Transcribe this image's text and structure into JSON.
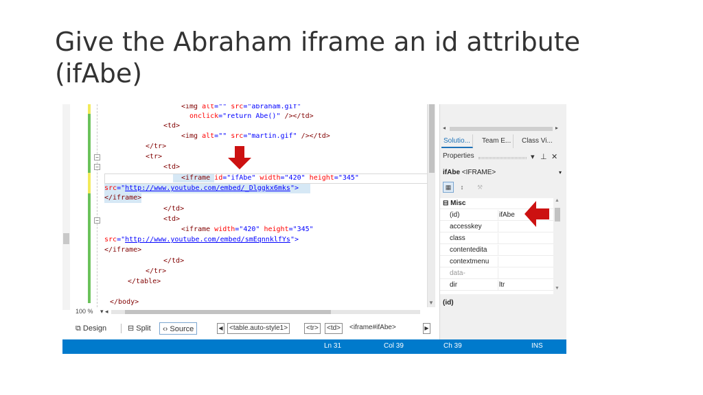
{
  "slide": {
    "title": "Give the Abraham iframe an id attribute (ifAbe)"
  },
  "code": {
    "line1": {
      "p1": "<img ",
      "p2": "alt",
      "p3": "=\"\" ",
      "p4": "src",
      "p5": "=\"abraham.gif\""
    },
    "line2": {
      "p1": "onclick",
      "p2": "=\"return Abe()\" ",
      "p3": "/></td>"
    },
    "line3": {
      "p1": "<td>"
    },
    "line4": {
      "p1": "<img ",
      "p2": "alt",
      "p3": "=\"\" ",
      "p4": "src",
      "p5": "=\"martin.gif\" ",
      "p6": "/></td>"
    },
    "line5": {
      "p1": "</tr>"
    },
    "line6": {
      "p1": "<tr>"
    },
    "line7": {
      "p1": "<td>"
    },
    "line8": {
      "p1": "<iframe ",
      "p2": "id",
      "p3": "=\"ifAbe\" ",
      "p4": "width",
      "p5": "=\"420\" ",
      "p6": "height",
      "p7": "=\"345\""
    },
    "line9": {
      "p1": "src",
      "p2": "=\"",
      "p3": "http://www.youtube.com/embed/_Dlggkx6mks",
      "p4": "\">"
    },
    "line10": {
      "p1": "</iframe>"
    },
    "line11": {
      "p1": "</td>"
    },
    "line12": {
      "p1": "<td>"
    },
    "line13": {
      "p1": "<iframe ",
      "p2": "width",
      "p3": "=\"420\" ",
      "p4": "height",
      "p5": "=\"345\""
    },
    "line14": {
      "p1": "src",
      "p2": "=\"",
      "p3": "http://www.youtube.com/embed/smEqnnklfYs",
      "p4": "\">"
    },
    "line15": {
      "p1": "</iframe>"
    },
    "line16": {
      "p1": "</td>"
    },
    "line17": {
      "p1": "</tr>"
    },
    "line18": {
      "p1": "</table>"
    },
    "line19": {
      "p1": "</body>"
    }
  },
  "editor": {
    "zoom": "100 %",
    "view_tabs": {
      "design": "Design",
      "split": "Split",
      "source": "Source"
    },
    "breadcrumbs": [
      "<table.auto-style1>",
      "<tr>",
      "<td>",
      "<iframe#ifAbe>"
    ]
  },
  "status_bar": {
    "ln": "Ln 31",
    "col": "Col 39",
    "ch": "Ch 39",
    "mode": "INS"
  },
  "right_panel": {
    "tabs": [
      "Solutio...",
      "Team E...",
      "Class Vi..."
    ],
    "properties_title": "Properties",
    "selected_object": {
      "name": "ifAbe",
      "type": "<IFRAME>"
    },
    "category": "Misc",
    "rows": [
      {
        "name": "(id)",
        "value": "ifAbe"
      },
      {
        "name": "accesskey",
        "value": ""
      },
      {
        "name": "class",
        "value": ""
      },
      {
        "name": "contentedita",
        "value": ""
      },
      {
        "name": "contextmenu",
        "value": ""
      },
      {
        "name": "data-",
        "value": ""
      },
      {
        "name": "dir",
        "value": "ltr"
      }
    ],
    "description_name": "(id)"
  },
  "colors": {
    "accent": "#007acc",
    "arrow": "#cc1111",
    "change_green": "#6bc25b",
    "change_yellow": "#f2ea5a"
  }
}
